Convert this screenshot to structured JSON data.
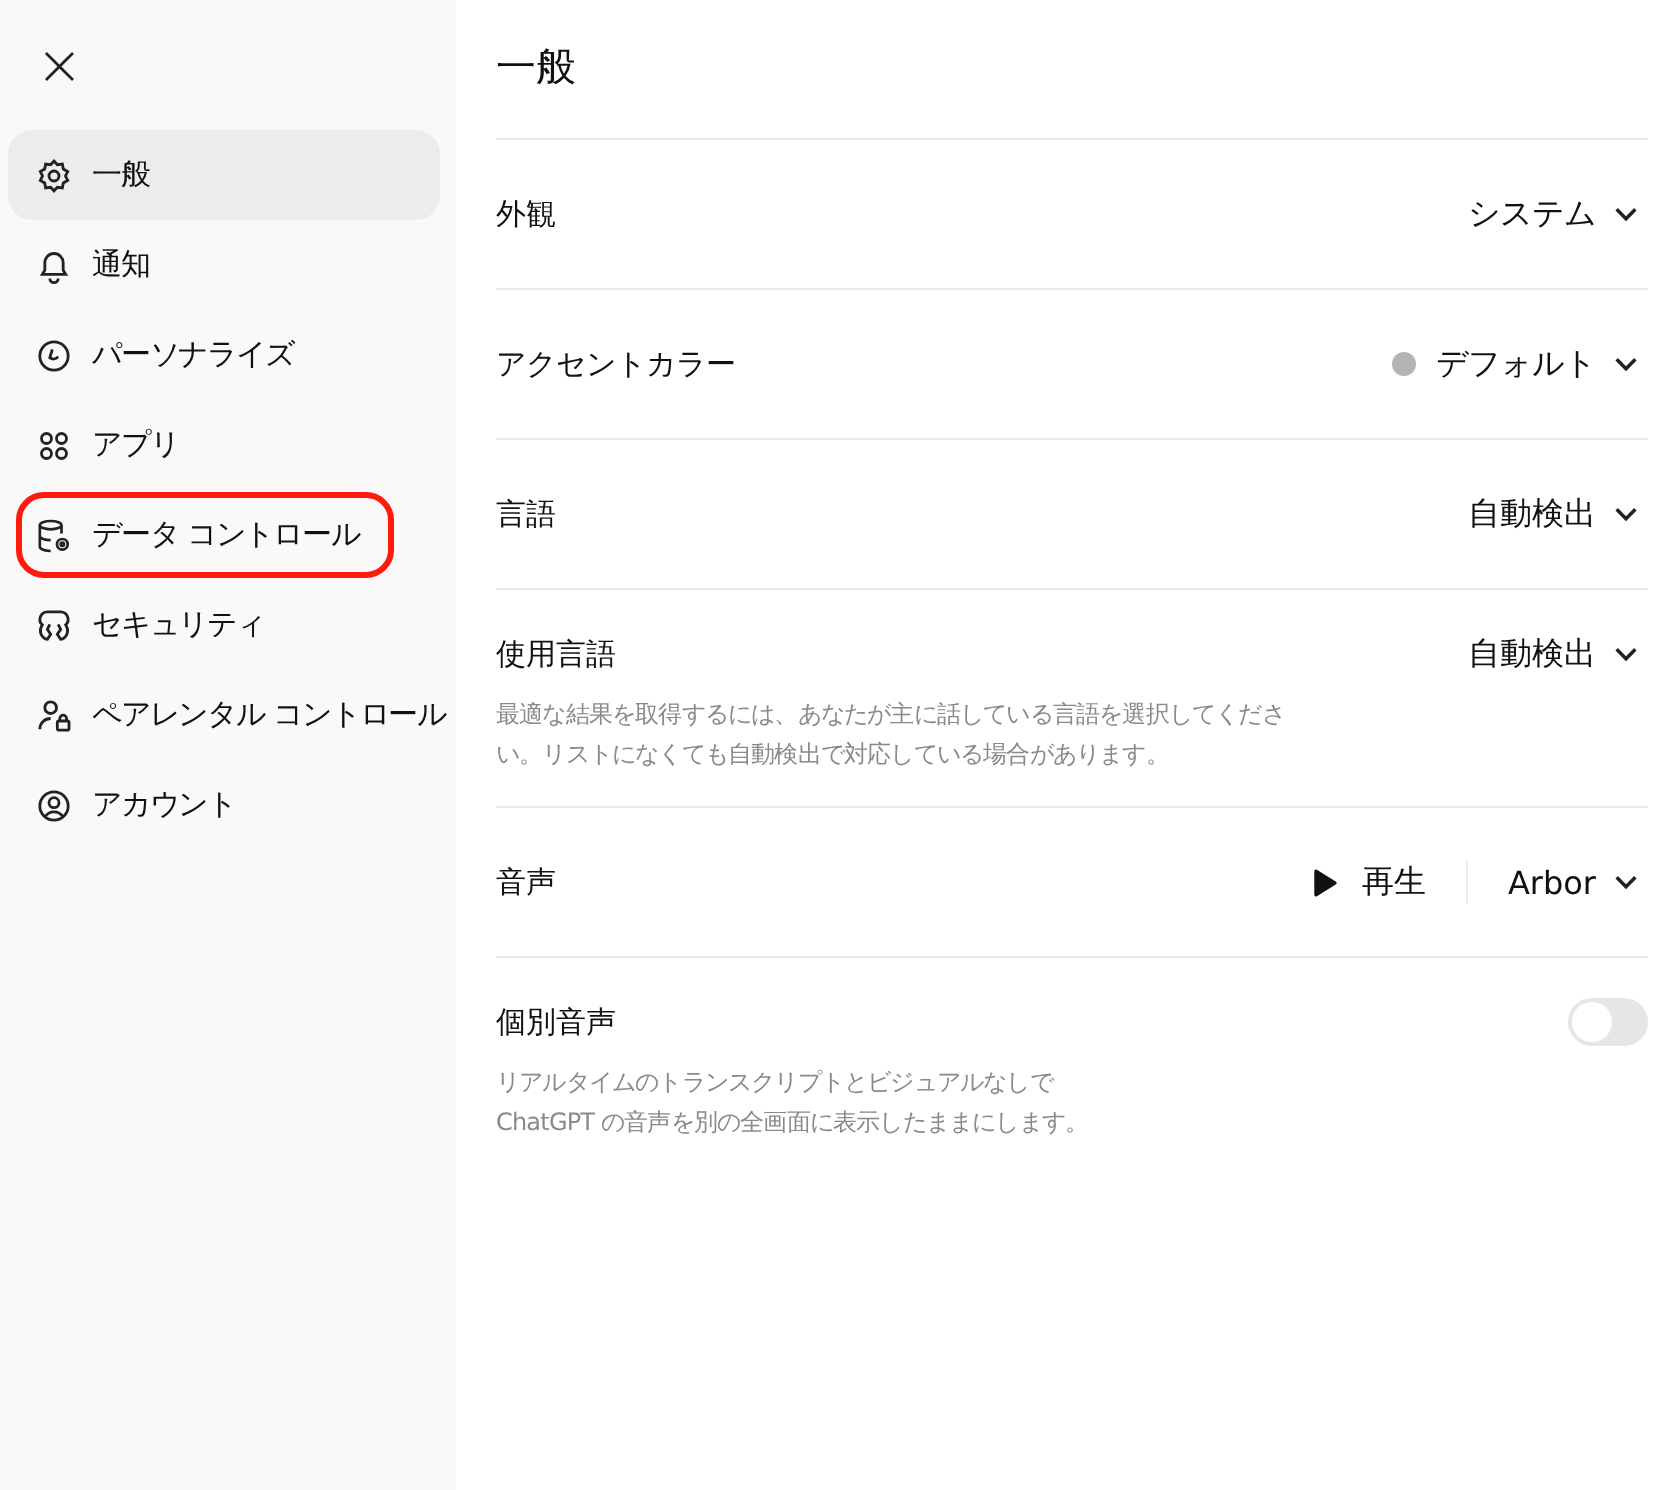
{
  "sidebar": {
    "close_label": "×",
    "items": [
      {
        "label": "一般",
        "selected": true,
        "highlighted": false
      },
      {
        "label": "通知",
        "selected": false,
        "highlighted": false
      },
      {
        "label": "パーソナライズ",
        "selected": false,
        "highlighted": false
      },
      {
        "label": "アプリ",
        "selected": false,
        "highlighted": false
      },
      {
        "label": "データ コントロール",
        "selected": false,
        "highlighted": true
      },
      {
        "label": "セキュリティ",
        "selected": false,
        "highlighted": false
      },
      {
        "label": "ペアレンタル コントロール",
        "selected": false,
        "highlighted": false
      },
      {
        "label": "アカウント",
        "selected": false,
        "highlighted": false
      }
    ]
  },
  "main": {
    "title": "一般",
    "settings": [
      {
        "kind": "dropdown",
        "label": "外観",
        "value": "システム"
      },
      {
        "kind": "dropdown",
        "label": "アクセントカラー",
        "value": "デフォルト",
        "color": "#b4b4b4"
      },
      {
        "kind": "dropdown",
        "label": "言語",
        "value": "自動検出"
      },
      {
        "kind": "dropdown",
        "label": "使用言語",
        "value": "自動検出",
        "description": "最適な結果を取得するには、あなたが主に話している言語を選択してください。リストになくても自動検出で対応している場合があります。"
      },
      {
        "kind": "voice",
        "label": "音声",
        "play_label": "再生",
        "value": "Arbor"
      },
      {
        "kind": "toggle",
        "label": "個別音声",
        "on": false,
        "description": "リアルタイムのトランスクリプトとビジュアルなしで\nChatGPT の音声を別の全画面に表示したままにします。"
      }
    ]
  }
}
